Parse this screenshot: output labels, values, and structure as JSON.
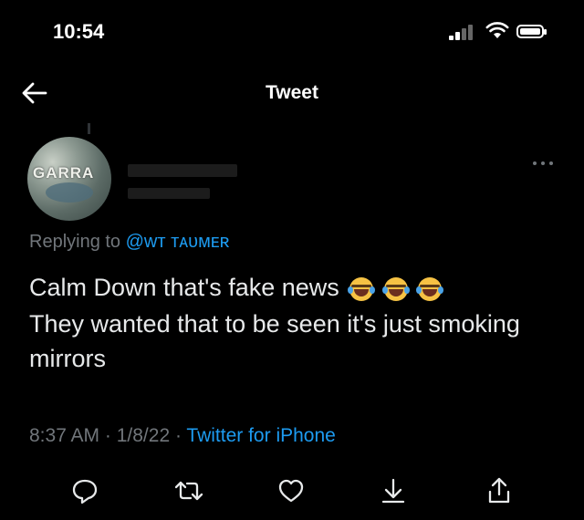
{
  "status_bar": {
    "time": "10:54"
  },
  "header": {
    "title": "Tweet"
  },
  "avatar": {
    "text": "GARRA"
  },
  "tweet": {
    "replying_prefix": "Replying to ",
    "replying_handle": "@ᴡᴛ ᴛᴀᴜᴍᴇʀ",
    "text_line1": "Calm Down that's fake news",
    "text_rest": "They wanted that to be seen it's just smoking mirrors",
    "time": "8:37 AM",
    "date": "1/8/22",
    "source": "Twitter for iPhone",
    "separator": " · "
  },
  "icons": {
    "back": "arrow-left-icon",
    "more": "more-horizontal-icon",
    "reply": "reply-icon",
    "retweet": "retweet-icon",
    "like": "heart-icon",
    "bookmark": "bookmark-download-icon",
    "share": "share-icon"
  },
  "colors": {
    "link": "#1d9bf0",
    "muted": "#71767b",
    "background": "#000000",
    "text": "#e7e9ea"
  }
}
